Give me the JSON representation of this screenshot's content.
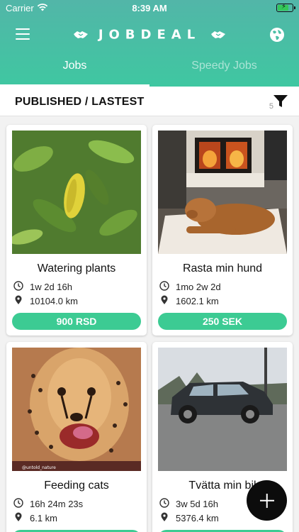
{
  "status_bar": {
    "carrier": "Carrier",
    "time": "8:39 AM"
  },
  "header": {
    "logo_text": "JOBDEAL"
  },
  "tabs": [
    {
      "label": "Jobs",
      "active": true
    },
    {
      "label": "Speedy Jobs",
      "active": false
    }
  ],
  "list_header": {
    "title": "PUBLISHED / LASTEST",
    "filter_count": "5"
  },
  "jobs": [
    {
      "title": "Watering plants",
      "time": "1w 2d 16h",
      "distance": "10104.0 km",
      "price": "900 RSD",
      "image": "plant"
    },
    {
      "title": "Rasta min hund",
      "time": "1mo 2w 2d",
      "distance": "1602.1 km",
      "price": "250 SEK",
      "image": "dog"
    },
    {
      "title": "Feeding cats",
      "time": "16h 24m 23s",
      "distance": "6.1 km",
      "price": "",
      "image": "cheetah"
    },
    {
      "title": "Tvätta min bil",
      "time": "3w 5d 16h",
      "distance": "5376.4 km",
      "price": "",
      "image": "car"
    }
  ],
  "image_captions": {
    "cheetah_watermark": "@untold_nature"
  },
  "colors": {
    "accent": "#3ccb93",
    "header_top": "#52b6a8",
    "header_bottom": "#3fc7a1",
    "fab": "#0c0c0c"
  }
}
